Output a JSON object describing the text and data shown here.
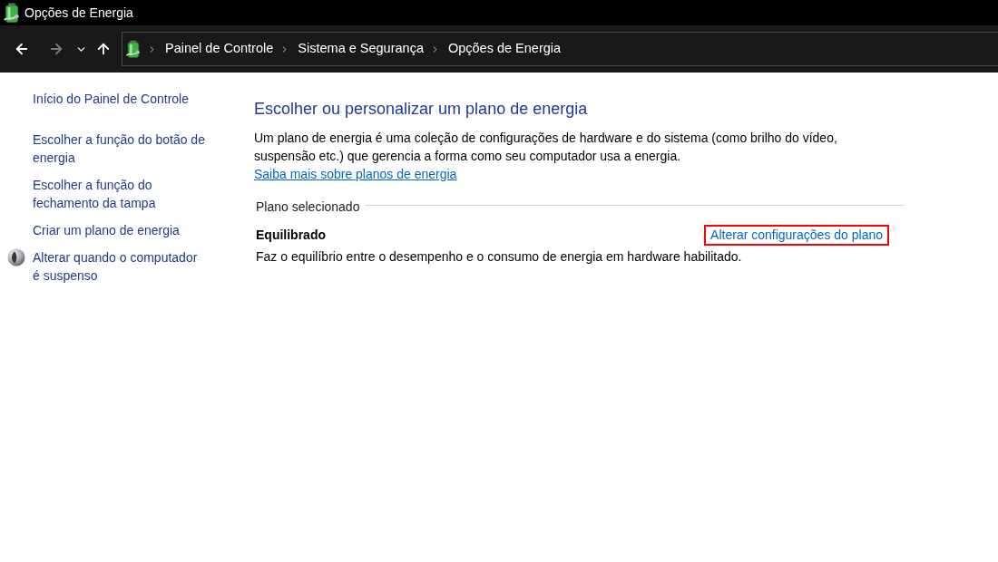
{
  "window": {
    "title": "Opções de Energia"
  },
  "navigation": {
    "buttons": [
      {
        "kind": "back",
        "disabled": false
      },
      {
        "kind": "forward",
        "disabled": true
      },
      {
        "kind": "recent",
        "disabled": false
      },
      {
        "kind": "up",
        "disabled": false
      }
    ],
    "breadcrumb": [
      "Painel de Controle",
      "Sistema e Segurança",
      "Opções de Energia"
    ]
  },
  "sidebar": {
    "home_link": "Início do Painel de Controle",
    "tasks": [
      {
        "label": "Escolher a função do botão de energia",
        "kind": "link"
      },
      {
        "label": "Escolher a função do fechamento da tampa",
        "kind": "link"
      },
      {
        "label": "Criar um plano de energia",
        "kind": "link"
      },
      {
        "label": "Alterar quando o computador é suspenso",
        "kind": "link_with_icon"
      }
    ]
  },
  "main": {
    "heading": "Escolher ou personalizar um plano de energia",
    "description": "Um plano de energia é uma coleção de configurações de hardware e do sistema (como brilho do vídeo, suspensão etc.) que gerencia a forma como seu computador usa a energia.",
    "learn_more_link": "Saiba mais sobre planos de energia",
    "section_label": "Plano selecionado",
    "selected_plan": {
      "name": "Equilibrado",
      "settings_link": {
        "label": "Alterar configurações do plano",
        "highlighted": true
      },
      "description": "Faz o equilíbrio entre o desempenho e o consumo de energia em hardware habilitado."
    }
  }
}
